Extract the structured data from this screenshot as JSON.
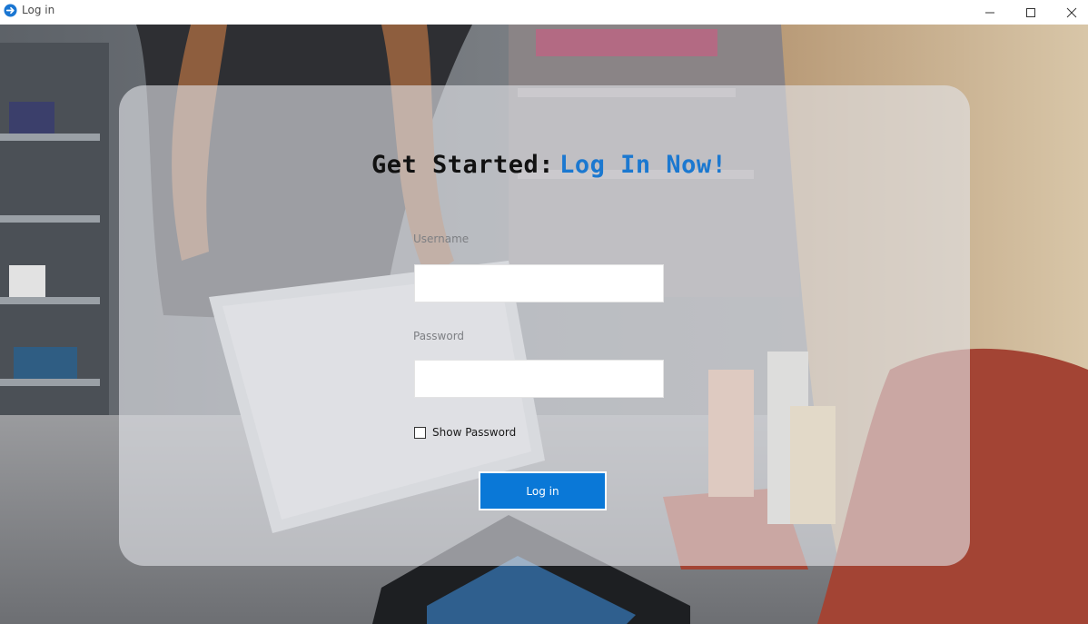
{
  "window": {
    "title": "Log in",
    "minimize_icon": "minimize-icon",
    "maximize_icon": "maximize-icon",
    "close_icon": "close-icon"
  },
  "login": {
    "heading_prefix": "Get Started:",
    "heading_accent": "Log In Now!",
    "username_label": "Username",
    "username_value": "",
    "password_label": "Password",
    "password_value": "",
    "show_password_label": "Show Password",
    "show_password_checked": false,
    "submit_label": "Log in"
  },
  "colors": {
    "accent": "#1b78d0",
    "button": "#0a78d7",
    "card_overlay": "rgba(226,228,232,0.62)"
  }
}
